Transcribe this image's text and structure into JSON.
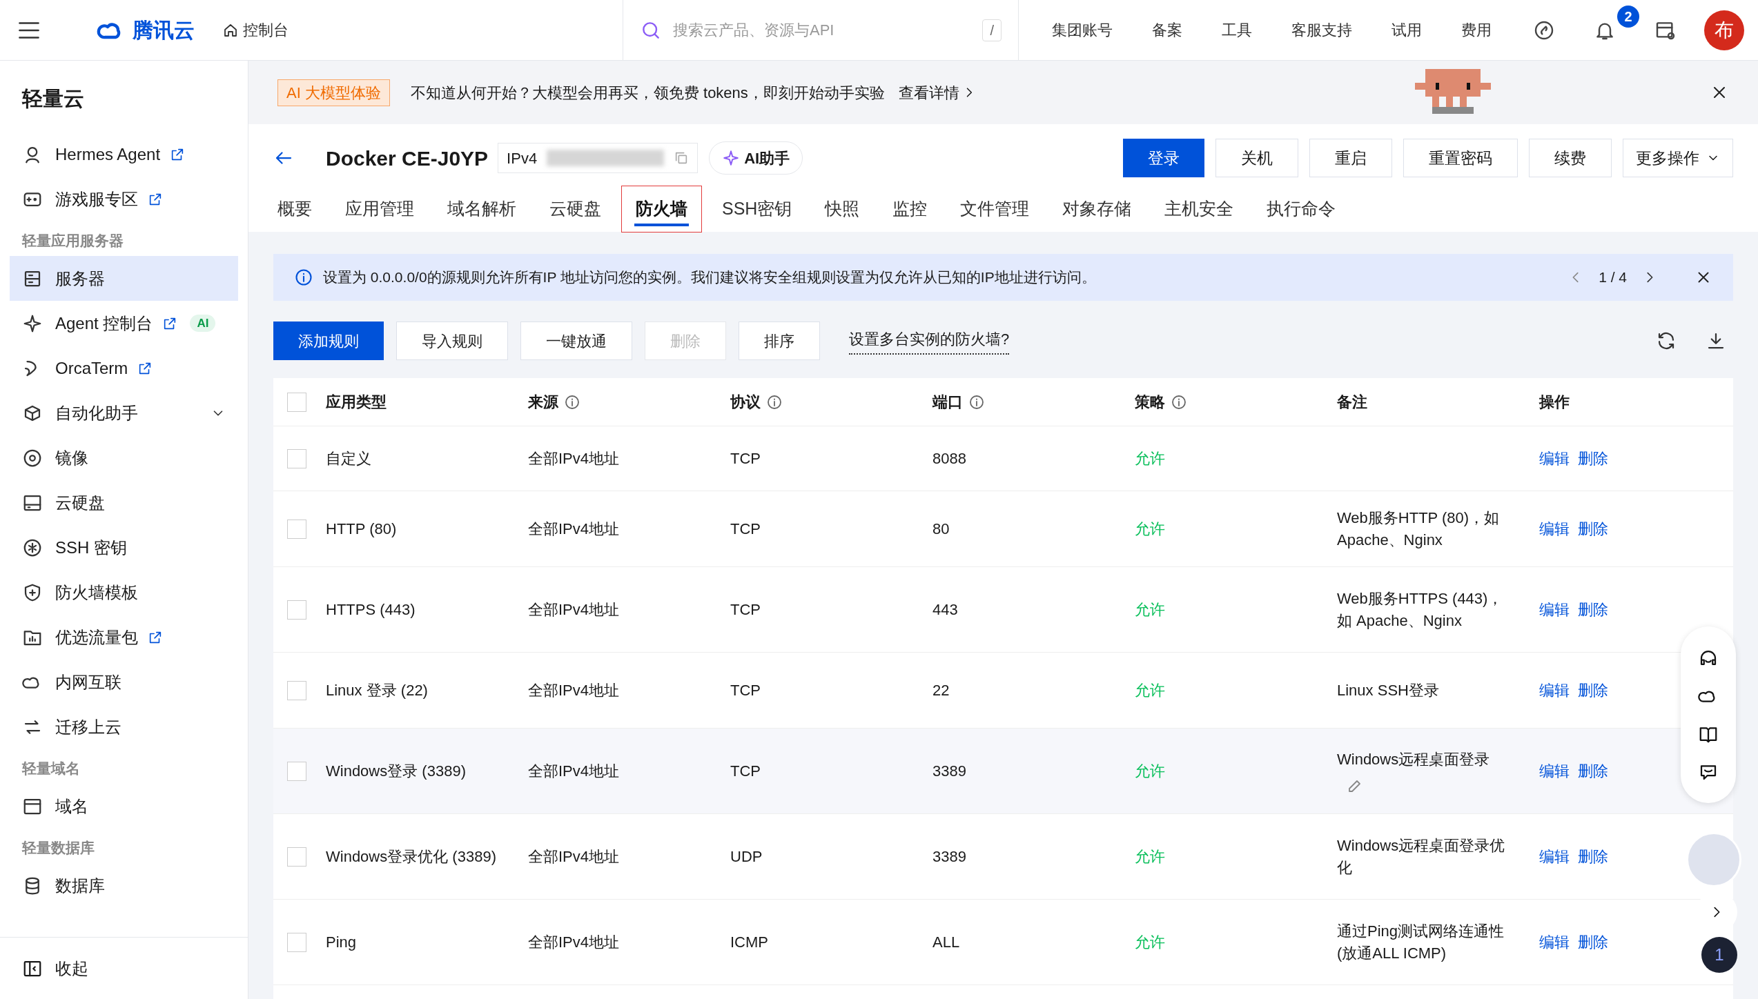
{
  "top_bar": {
    "brand": "腾讯云",
    "console": "控制台",
    "search_placeholder": "搜索云产品、资源与API",
    "shortcut": "/",
    "nav": [
      "集团账号",
      "备案",
      "工具",
      "客服支持",
      "试用",
      "费用"
    ],
    "notification_count": "2",
    "avatar_letter": "布"
  },
  "sidebar": {
    "title": "轻量云",
    "items": [
      {
        "kind": "item",
        "label": "Hermes Agent",
        "external": true,
        "selected": false
      },
      {
        "kind": "item",
        "label": "游戏服专区",
        "external": true,
        "selected": false
      },
      {
        "kind": "heading",
        "label": "轻量应用服务器"
      },
      {
        "kind": "item",
        "label": "服务器",
        "external": false,
        "selected": true
      },
      {
        "kind": "item",
        "label": "Agent 控制台",
        "external": true,
        "badge": "AI",
        "selected": false
      },
      {
        "kind": "item",
        "label": "OrcaTerm",
        "external": true,
        "selected": false
      },
      {
        "kind": "item",
        "label": "自动化助手",
        "external": false,
        "expanded": false,
        "selected": false
      },
      {
        "kind": "item",
        "label": "镜像",
        "external": false,
        "selected": false
      },
      {
        "kind": "item",
        "label": "云硬盘",
        "external": false,
        "selected": false
      },
      {
        "kind": "item",
        "label": "SSH 密钥",
        "external": false,
        "selected": false
      },
      {
        "kind": "item",
        "label": "防火墙模板",
        "external": false,
        "selected": false
      },
      {
        "kind": "item",
        "label": "优选流量包",
        "external": true,
        "selected": false
      },
      {
        "kind": "item",
        "label": "内网互联",
        "external": false,
        "selected": false
      },
      {
        "kind": "item",
        "label": "迁移上云",
        "external": false,
        "selected": false
      },
      {
        "kind": "heading",
        "label": "轻量域名"
      },
      {
        "kind": "item",
        "label": "域名",
        "external": false,
        "selected": false
      },
      {
        "kind": "heading",
        "label": "轻量数据库"
      },
      {
        "kind": "item",
        "label": "数据库",
        "external": false,
        "selected": false
      }
    ],
    "collapse": "收起"
  },
  "banner": {
    "tag": "AI 大模型体验",
    "text": "不知道从何开始？大模型会用再买，领免费 tokens，即刻开始动手实验",
    "link": "查看详情"
  },
  "instance": {
    "name": "Docker CE-J0YP",
    "ip_label": "IPv4",
    "ai_button": "AI助手",
    "actions": [
      {
        "label": "登录",
        "primary": true
      },
      {
        "label": "关机",
        "primary": false
      },
      {
        "label": "重启",
        "primary": false
      },
      {
        "label": "重置密码",
        "primary": false
      },
      {
        "label": "续费",
        "primary": false
      }
    ],
    "more": "更多操作"
  },
  "tabs": [
    {
      "label": "概要",
      "selected": false
    },
    {
      "label": "应用管理",
      "selected": false
    },
    {
      "label": "域名解析",
      "selected": false
    },
    {
      "label": "云硬盘",
      "selected": false
    },
    {
      "label": "防火墙",
      "selected": true
    },
    {
      "label": "SSH密钥",
      "selected": false
    },
    {
      "label": "快照",
      "selected": false
    },
    {
      "label": "监控",
      "selected": false
    },
    {
      "label": "文件管理",
      "selected": false
    },
    {
      "label": "对象存储",
      "selected": false
    },
    {
      "label": "主机安全",
      "selected": false
    },
    {
      "label": "执行命令",
      "selected": false
    }
  ],
  "alert": {
    "text": "设置为 0.0.0.0/0的源规则允许所有IP 地址访问您的实例。我们建议将安全组规则设置为仅允许从已知的IP地址进行访问。",
    "pager": "1 / 4"
  },
  "toolbar": {
    "buttons": [
      {
        "label": "添加规则",
        "kind": "primary"
      },
      {
        "label": "导入规则",
        "kind": "default"
      },
      {
        "label": "一键放通",
        "kind": "default"
      },
      {
        "label": "删除",
        "kind": "disabled"
      },
      {
        "label": "排序",
        "kind": "default"
      }
    ],
    "link": "设置多台实例的防火墙?"
  },
  "table": {
    "header_checked": false,
    "columns": [
      {
        "label": "应用类型",
        "info": false
      },
      {
        "label": "来源",
        "info": true
      },
      {
        "label": "协议",
        "info": true
      },
      {
        "label": "端口",
        "info": true
      },
      {
        "label": "策略",
        "info": true
      },
      {
        "label": "备注",
        "info": false
      },
      {
        "label": "操作",
        "info": false
      }
    ],
    "rows": [
      {
        "checked": false,
        "highlighted": false,
        "type": "自定义",
        "source": "全部IPv4地址",
        "protocol": "TCP",
        "port": "8088",
        "policy": "允许",
        "note": "",
        "actions": [
          "编辑",
          "删除"
        ]
      },
      {
        "checked": false,
        "highlighted": false,
        "type": "HTTP (80)",
        "source": "全部IPv4地址",
        "protocol": "TCP",
        "port": "80",
        "policy": "允许",
        "note": "Web服务HTTP (80)，如Apache、Nginx",
        "actions": [
          "编辑",
          "删除"
        ]
      },
      {
        "checked": false,
        "highlighted": false,
        "type": "HTTPS (443)",
        "source": "全部IPv4地址",
        "protocol": "TCP",
        "port": "443",
        "policy": "允许",
        "note": "Web服务HTTPS (443)，如 Apache、Nginx",
        "actions": [
          "编辑",
          "删除"
        ]
      },
      {
        "checked": false,
        "highlighted": false,
        "type": "Linux 登录 (22)",
        "source": "全部IPv4地址",
        "protocol": "TCP",
        "port": "22",
        "policy": "允许",
        "note": "Linux SSH登录",
        "actions": [
          "编辑",
          "删除"
        ]
      },
      {
        "checked": false,
        "highlighted": true,
        "type": "Windows登录 (3389)",
        "source": "全部IPv4地址",
        "protocol": "TCP",
        "port": "3389",
        "policy": "允许",
        "note": "Windows远程桌面登录",
        "actions": [
          "编辑",
          "删除"
        ]
      },
      {
        "checked": false,
        "highlighted": false,
        "type": "Windows登录优化 (3389)",
        "source": "全部IPv4地址",
        "protocol": "UDP",
        "port": "3389",
        "policy": "允许",
        "note": "Windows远程桌面登录优化",
        "actions": [
          "编辑",
          "删除"
        ]
      },
      {
        "checked": false,
        "highlighted": false,
        "type": "Ping",
        "source": "全部IPv4地址",
        "protocol": "ICMP",
        "port": "ALL",
        "policy": "允许",
        "note": "通过Ping测试网络连通性(放通ALL ICMP)",
        "actions": [
          "编辑",
          "删除"
        ]
      }
    ]
  },
  "float_tools": {
    "count": "1"
  }
}
